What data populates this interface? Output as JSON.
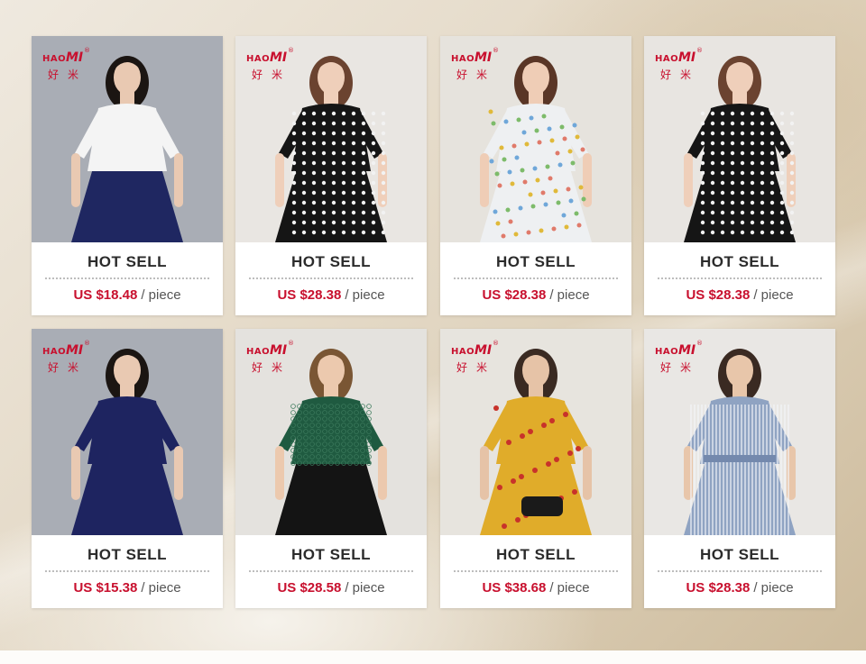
{
  "brand": {
    "hao": "HAO",
    "mi": "MI",
    "reg": "®",
    "hanzi": "好米"
  },
  "colors": {
    "accent": "#c8102e",
    "title": "#2b2b2b"
  },
  "products": [
    {
      "title": "HOT SELL",
      "price": "US $18.48",
      "unit": "/ piece",
      "item": "white blouse",
      "bg": "#a9adb5",
      "top": "#f4f4f4",
      "bottom": "#1f2761",
      "pattern": "plain",
      "skin": "#e9c9b2",
      "hair": "#1b1512"
    },
    {
      "title": "HOT SELL",
      "price": "US $28.38",
      "unit": "/ piece",
      "item": "polka dot dress",
      "bg": "#e9e6e2",
      "top": "#151515",
      "bottom": "#151515",
      "pattern": "dots",
      "skin": "#efcfba",
      "hair": "#6b4330"
    },
    {
      "title": "HOT SELL",
      "price": "US $28.38",
      "unit": "/ piece",
      "item": "floral dress",
      "bg": "#e6e3dd",
      "top": "#eef0f2",
      "bottom": "#eef0f2",
      "pattern": "floral",
      "skin": "#efcdb6",
      "hair": "#5a3626"
    },
    {
      "title": "HOT SELL",
      "price": "US $28.38",
      "unit": "/ piece",
      "item": "polka dot jumpsuit",
      "bg": "#e8e5e1",
      "top": "#151515",
      "bottom": "#151515",
      "pattern": "dots",
      "skin": "#efcfba",
      "hair": "#6b4330"
    },
    {
      "title": "HOT SELL",
      "price": "US $15.38",
      "unit": "/ piece",
      "item": "navy sleeveless dress",
      "bg": "#a9adb5",
      "top": "#1e2460",
      "bottom": "#1e2460",
      "pattern": "plain",
      "skin": "#e9c9b2",
      "hair": "#1b1512"
    },
    {
      "title": "HOT SELL",
      "price": "US $28.58",
      "unit": "/ piece",
      "item": "green lace top",
      "bg": "#e4e2de",
      "top": "#1f5a40",
      "bottom": "#141414",
      "pattern": "lace",
      "skin": "#ecc9ae",
      "hair": "#7a5634"
    },
    {
      "title": "HOT SELL",
      "price": "US $38.68",
      "unit": "/ piece",
      "item": "yellow print dress",
      "bg": "#e7e4de",
      "top": "#e0ac2a",
      "bottom": "#e0ac2a",
      "pattern": "hearts",
      "skin": "#e6c3a7",
      "hair": "#3a2a22"
    },
    {
      "title": "HOT SELL",
      "price": "US $28.38",
      "unit": "/ piece",
      "item": "striped shirt dress",
      "bg": "#e9e7e4",
      "top": "#8fa3c2",
      "bottom": "#8fa3c2",
      "pattern": "stripes",
      "skin": "#e8c6aa",
      "hair": "#3a2a22"
    }
  ]
}
